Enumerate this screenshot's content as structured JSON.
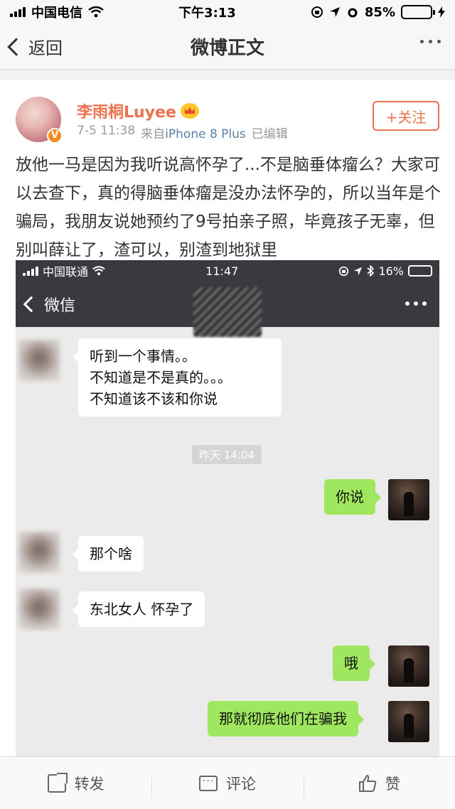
{
  "status_bar": {
    "carrier": "中国电信",
    "time": "下午3:13",
    "battery_pct": "85%",
    "battery_level": 0.85
  },
  "nav": {
    "back_label": "返回",
    "title": "微博正文"
  },
  "post": {
    "username": "李雨桐Luyee",
    "date": "7-5 11:38",
    "source_prefix": "来自",
    "source": "iPhone 8 Plus",
    "edited": "已编辑",
    "follow_label": "+关注",
    "text": "放他一马是因为我听说高怀孕了...不是脑垂体瘤么？大家可以去查下，真的得脑垂体瘤是没办法怀孕的，所以当年是个骗局，我朋友说她预约了9号拍亲子照，毕竟孩子无辜，但别叫薛让了，渣可以，别渣到地狱里"
  },
  "screenshot": {
    "carrier": "中国联通",
    "time": "11:47",
    "battery_pct": "16%",
    "back_label": "微信",
    "timestamp": "昨天 14:04",
    "messages": [
      {
        "side": "left",
        "lines": [
          "听到一个事情。。",
          "不知道是不是真的。。。",
          "不知道该不该和你说"
        ]
      },
      {
        "side": "right",
        "text": "你说"
      },
      {
        "side": "left",
        "text": "那个啥"
      },
      {
        "side": "left",
        "text": "东北女人 怀孕了"
      },
      {
        "side": "right",
        "text": "哦"
      },
      {
        "side": "right",
        "text": "那就彻底他们在骗我"
      }
    ]
  },
  "actions": {
    "repost": "转发",
    "comment": "评论",
    "like": "赞"
  },
  "colors": {
    "accent": "#eb7350",
    "link": "#5d7fa6",
    "wechat_green": "#9fe75e",
    "wechat_bar": "#393a3f"
  }
}
